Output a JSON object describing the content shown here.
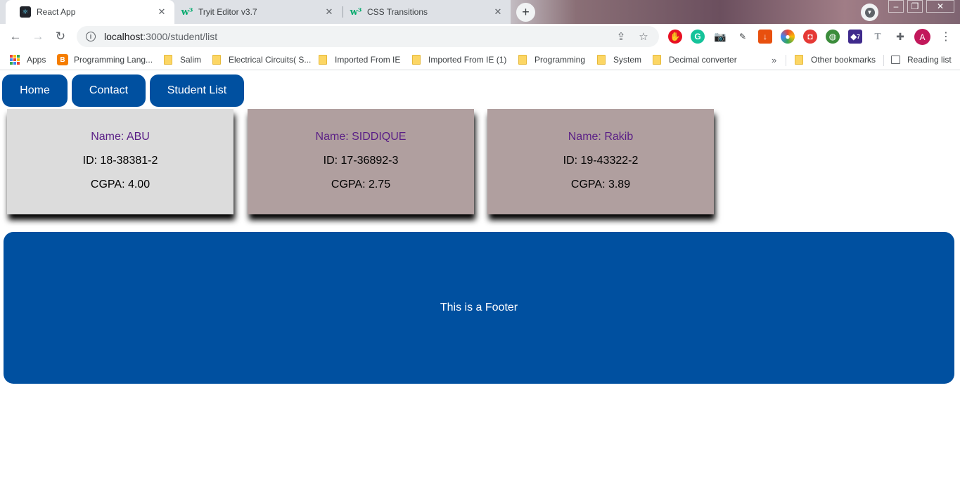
{
  "tabs": [
    {
      "title": "React App",
      "active": true,
      "favicon": "react-favicon"
    },
    {
      "title": "Tryit Editor v3.7",
      "active": false,
      "favicon": "w3schools-favicon"
    },
    {
      "title": "CSS Transitions",
      "active": false,
      "favicon": "w3schools-favicon"
    }
  ],
  "address_bar": {
    "host": "localhost",
    "port_path": ":3000/student/list"
  },
  "bookmarks": {
    "apps": "Apps",
    "items": [
      "Programming Lang...",
      "Salim",
      "Electrical Circuits( S...",
      "Imported From IE",
      "Imported From IE (1)",
      "Programming",
      "System",
      "Decimal converter"
    ],
    "more": "»",
    "other": "Other bookmarks",
    "reading_list": "Reading list"
  },
  "profile_initial": "A",
  "extension_badge": "7",
  "nav": {
    "home": "Home",
    "contact": "Contact",
    "student_list": "Student List"
  },
  "students": [
    {
      "name": "Name: ABU",
      "id": "ID: 18-38381-2",
      "cgpa": "CGPA: 4.00",
      "bg": "#dcdcdc"
    },
    {
      "name": "Name: SIDDIQUE",
      "id": "ID: 17-36892-3",
      "cgpa": "CGPA: 2.75",
      "bg": "#b09f9f"
    },
    {
      "name": "Name: Rakib",
      "id": "ID: 19-43322-2",
      "cgpa": "CGPA: 3.89",
      "bg": "#b09f9f"
    }
  ],
  "footer": {
    "text": "This is a Footer"
  },
  "colors": {
    "nav_blue": "#0050a0",
    "name_purple": "#5a1f86"
  }
}
